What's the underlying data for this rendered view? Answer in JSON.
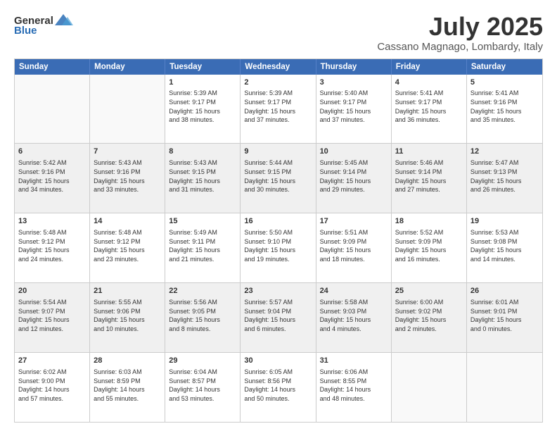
{
  "logo": {
    "general": "General",
    "blue": "Blue"
  },
  "title": "July 2025",
  "location": "Cassano Magnago, Lombardy, Italy",
  "weekdays": [
    "Sunday",
    "Monday",
    "Tuesday",
    "Wednesday",
    "Thursday",
    "Friday",
    "Saturday"
  ],
  "rows": [
    [
      {
        "day": "",
        "text": ""
      },
      {
        "day": "",
        "text": ""
      },
      {
        "day": "1",
        "text": "Sunrise: 5:39 AM\nSunset: 9:17 PM\nDaylight: 15 hours\nand 38 minutes."
      },
      {
        "day": "2",
        "text": "Sunrise: 5:39 AM\nSunset: 9:17 PM\nDaylight: 15 hours\nand 37 minutes."
      },
      {
        "day": "3",
        "text": "Sunrise: 5:40 AM\nSunset: 9:17 PM\nDaylight: 15 hours\nand 37 minutes."
      },
      {
        "day": "4",
        "text": "Sunrise: 5:41 AM\nSunset: 9:17 PM\nDaylight: 15 hours\nand 36 minutes."
      },
      {
        "day": "5",
        "text": "Sunrise: 5:41 AM\nSunset: 9:16 PM\nDaylight: 15 hours\nand 35 minutes."
      }
    ],
    [
      {
        "day": "6",
        "text": "Sunrise: 5:42 AM\nSunset: 9:16 PM\nDaylight: 15 hours\nand 34 minutes."
      },
      {
        "day": "7",
        "text": "Sunrise: 5:43 AM\nSunset: 9:16 PM\nDaylight: 15 hours\nand 33 minutes."
      },
      {
        "day": "8",
        "text": "Sunrise: 5:43 AM\nSunset: 9:15 PM\nDaylight: 15 hours\nand 31 minutes."
      },
      {
        "day": "9",
        "text": "Sunrise: 5:44 AM\nSunset: 9:15 PM\nDaylight: 15 hours\nand 30 minutes."
      },
      {
        "day": "10",
        "text": "Sunrise: 5:45 AM\nSunset: 9:14 PM\nDaylight: 15 hours\nand 29 minutes."
      },
      {
        "day": "11",
        "text": "Sunrise: 5:46 AM\nSunset: 9:14 PM\nDaylight: 15 hours\nand 27 minutes."
      },
      {
        "day": "12",
        "text": "Sunrise: 5:47 AM\nSunset: 9:13 PM\nDaylight: 15 hours\nand 26 minutes."
      }
    ],
    [
      {
        "day": "13",
        "text": "Sunrise: 5:48 AM\nSunset: 9:12 PM\nDaylight: 15 hours\nand 24 minutes."
      },
      {
        "day": "14",
        "text": "Sunrise: 5:48 AM\nSunset: 9:12 PM\nDaylight: 15 hours\nand 23 minutes."
      },
      {
        "day": "15",
        "text": "Sunrise: 5:49 AM\nSunset: 9:11 PM\nDaylight: 15 hours\nand 21 minutes."
      },
      {
        "day": "16",
        "text": "Sunrise: 5:50 AM\nSunset: 9:10 PM\nDaylight: 15 hours\nand 19 minutes."
      },
      {
        "day": "17",
        "text": "Sunrise: 5:51 AM\nSunset: 9:09 PM\nDaylight: 15 hours\nand 18 minutes."
      },
      {
        "day": "18",
        "text": "Sunrise: 5:52 AM\nSunset: 9:09 PM\nDaylight: 15 hours\nand 16 minutes."
      },
      {
        "day": "19",
        "text": "Sunrise: 5:53 AM\nSunset: 9:08 PM\nDaylight: 15 hours\nand 14 minutes."
      }
    ],
    [
      {
        "day": "20",
        "text": "Sunrise: 5:54 AM\nSunset: 9:07 PM\nDaylight: 15 hours\nand 12 minutes."
      },
      {
        "day": "21",
        "text": "Sunrise: 5:55 AM\nSunset: 9:06 PM\nDaylight: 15 hours\nand 10 minutes."
      },
      {
        "day": "22",
        "text": "Sunrise: 5:56 AM\nSunset: 9:05 PM\nDaylight: 15 hours\nand 8 minutes."
      },
      {
        "day": "23",
        "text": "Sunrise: 5:57 AM\nSunset: 9:04 PM\nDaylight: 15 hours\nand 6 minutes."
      },
      {
        "day": "24",
        "text": "Sunrise: 5:58 AM\nSunset: 9:03 PM\nDaylight: 15 hours\nand 4 minutes."
      },
      {
        "day": "25",
        "text": "Sunrise: 6:00 AM\nSunset: 9:02 PM\nDaylight: 15 hours\nand 2 minutes."
      },
      {
        "day": "26",
        "text": "Sunrise: 6:01 AM\nSunset: 9:01 PM\nDaylight: 15 hours\nand 0 minutes."
      }
    ],
    [
      {
        "day": "27",
        "text": "Sunrise: 6:02 AM\nSunset: 9:00 PM\nDaylight: 14 hours\nand 57 minutes."
      },
      {
        "day": "28",
        "text": "Sunrise: 6:03 AM\nSunset: 8:59 PM\nDaylight: 14 hours\nand 55 minutes."
      },
      {
        "day": "29",
        "text": "Sunrise: 6:04 AM\nSunset: 8:57 PM\nDaylight: 14 hours\nand 53 minutes."
      },
      {
        "day": "30",
        "text": "Sunrise: 6:05 AM\nSunset: 8:56 PM\nDaylight: 14 hours\nand 50 minutes."
      },
      {
        "day": "31",
        "text": "Sunrise: 6:06 AM\nSunset: 8:55 PM\nDaylight: 14 hours\nand 48 minutes."
      },
      {
        "day": "",
        "text": ""
      },
      {
        "day": "",
        "text": ""
      }
    ]
  ]
}
